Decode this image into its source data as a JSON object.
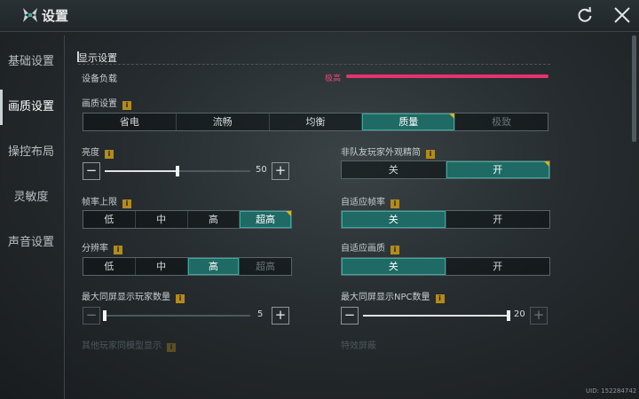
{
  "app": {
    "title": "设置",
    "uid": "UID: 152284742"
  },
  "sidebar": {
    "items": [
      {
        "label": "基础设置"
      },
      {
        "label": "画质设置"
      },
      {
        "label": "操控布局"
      },
      {
        "label": "灵敏度"
      },
      {
        "label": "声音设置"
      }
    ],
    "active_index": 1
  },
  "section": {
    "title": "显示设置"
  },
  "device_load": {
    "label": "设备负载",
    "value": "极高",
    "level": 1.0,
    "color": "#e5336c"
  },
  "quality": {
    "label": "画质设置",
    "options": [
      "省电",
      "流畅",
      "均衡",
      "质量",
      "极致"
    ],
    "selected": "质量",
    "disabled": [
      "极致"
    ]
  },
  "brightness": {
    "label": "亮度",
    "value": "50",
    "level": 0.5
  },
  "non_team_simplify": {
    "label": "非队友玩家外观精简",
    "options": [
      "关",
      "开"
    ],
    "selected": "开"
  },
  "frame_limit": {
    "label": "帧率上限",
    "options": [
      "低",
      "中",
      "高",
      "超高"
    ],
    "selected": "超高"
  },
  "adaptive_framerate": {
    "label": "自适应帧率",
    "options": [
      "关",
      "开"
    ],
    "selected": "关"
  },
  "resolution": {
    "label": "分辨率",
    "options": [
      "低",
      "中",
      "高",
      "超高"
    ],
    "selected": "高",
    "disabled": [
      "超高"
    ]
  },
  "adaptive_quality": {
    "label": "自适应画质",
    "options": [
      "关",
      "开"
    ],
    "selected": "关"
  },
  "max_players": {
    "label": "最大同屏显示玩家数量",
    "value": "5",
    "level": 0.0
  },
  "max_npc": {
    "label": "最大同屏显示NPC数量",
    "value": "20",
    "level": 1.0
  },
  "faded_labels": [
    "其他玩家同模型显示",
    "特效屏蔽"
  ],
  "colors": {
    "accent": "#1f6a64",
    "accent_border": "#3aa89e",
    "badge": "#d4b42a",
    "warning": "#e5336c"
  }
}
